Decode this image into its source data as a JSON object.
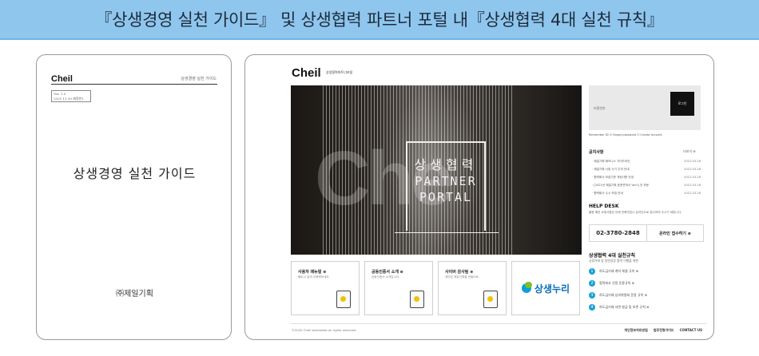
{
  "header": {
    "title": "『상생경영 실천 가이드』 및 상생협력 파트너 포털 내『상생협력 4대 실천 규칙』"
  },
  "guide": {
    "logo": "Cheil",
    "top_title": "상생경영 실천 가이드",
    "version": "Ver. 1.0",
    "version_date": "2021.11.30 제정판1",
    "title": "상생경영 실천 가이드",
    "company": "㈜제일기획"
  },
  "portal": {
    "logo": "Cheil",
    "logo_sub": "상생협력파트너포털",
    "hero": {
      "brand_bg": "Che",
      "title_ko": "상생협력",
      "title_en1": "PARTNER",
      "title_en2": "PORTAL"
    },
    "login": {
      "password_label": "비밀번호",
      "button": "로그인",
      "options": "Remember ID  ⚿ Forgot password  ⚿ Create account"
    },
    "notice": {
      "title": "공지사항",
      "more": "더보기 ⊕",
      "items": [
        {
          "text": "· 제일기획 배즈니스 가이드라인",
          "date": "2022-03-28"
        },
        {
          "text": "· 제일기획 사칭 사기 주의 안내",
          "date": "2022-03-28"
        },
        {
          "text": "· 협력회사 모집기준 개정사항 안내",
          "date": "2022-03-28"
        },
        {
          "text": "· [2021년 제일기획 표준견적서 Ver1] 전 부문",
          "date": "2022-03-28"
        },
        {
          "text": "· 협력회사 수시 모집 안내",
          "date": "2022-03-28"
        }
      ]
    },
    "helpdesk": {
      "title": "HELP DESK",
      "desc": "불편 혜전 요청사항은 아래 전화번호나 온라인으로 접수하여 주시기 바랍니다.",
      "phone": "02-3780-2848",
      "online": "온라인 접수하기 ⊕"
    },
    "rules": {
      "title": "상생협력 4대 실천규칙",
      "subtitle": "공정거래 및 동반성장 협력 이행을 위한",
      "items": [
        "하도급거래 계약 체결 규칙 ⊕",
        "협력회사 선정 운용규칙 ⊕",
        "하도급거래 심의위원회 운용 규칙 ⊕",
        "하도급거래 서면 발급 및 보존 규칙 ⊕"
      ]
    },
    "features": [
      {
        "title": "사용자 매뉴얼 ⊕",
        "sub": "빠르고 쉽게 이용해보세요."
      },
      {
        "title": "공동인증서 소개 ⊕",
        "sub": "공동인증서 소개입니다."
      },
      {
        "title": "사이버 감사팀 ⊕",
        "sub": "제안된 제일기획을 만들어요."
      },
      {
        "title": "상생누리",
        "sub": ""
      }
    ],
    "footer": {
      "copyright": "©2020 Cheil worldwide all rights reserved.",
      "links": [
        "개인정보처리방침",
        "법무전형가이드",
        "CONTACT US"
      ]
    }
  }
}
